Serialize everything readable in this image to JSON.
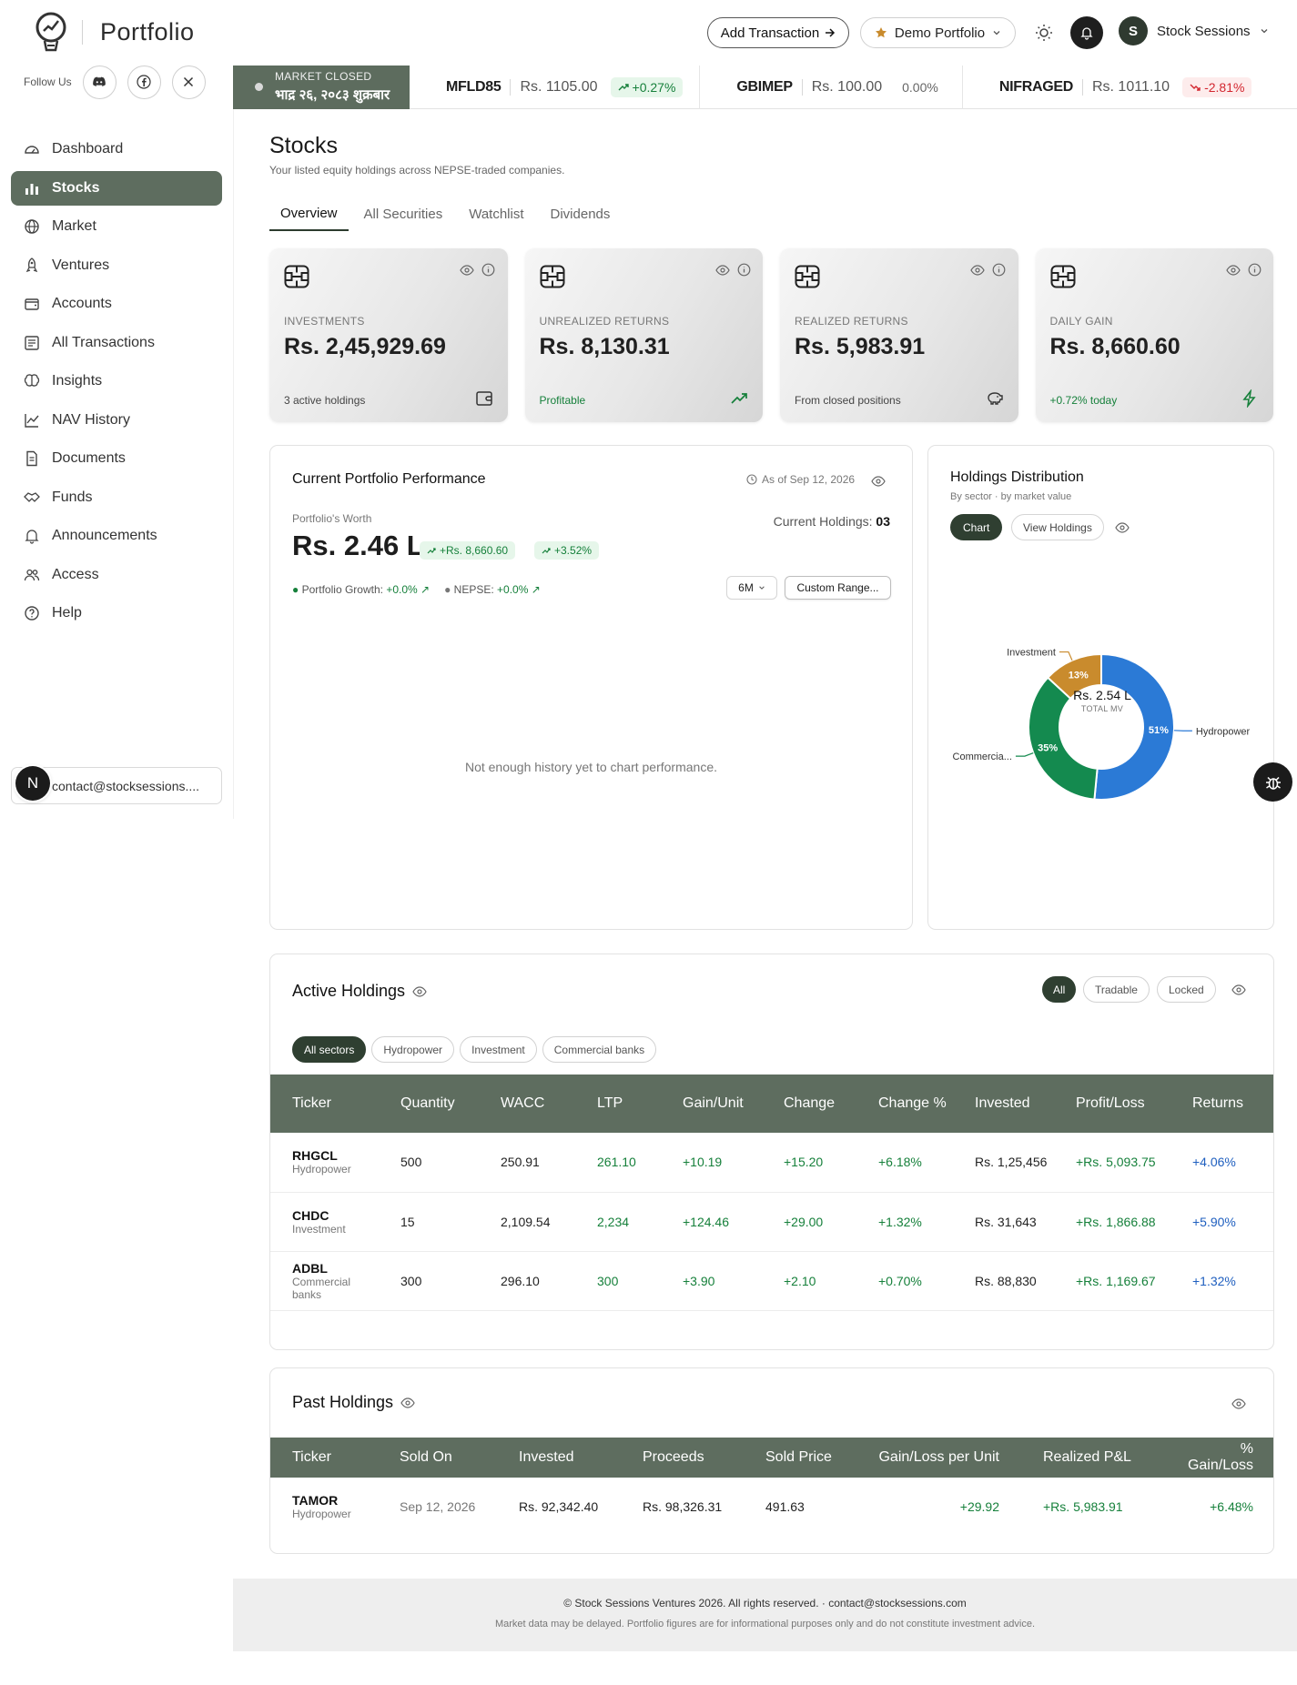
{
  "header": {
    "brand": "Portfolio",
    "add_transaction": "Add Transaction",
    "portfolio_select": "Demo Portfolio",
    "user_initial": "S",
    "user_name": "Stock Sessions"
  },
  "follow": {
    "label": "Follow Us"
  },
  "ticker": {
    "status": "MARKET CLOSED",
    "date": "भाद्र २६, २०८३ शुक्रबार",
    "items": [
      {
        "symbol": "MFLD85",
        "price": "Rs. 1105.00",
        "change": "+0.27%"
      },
      {
        "symbol": "GBIMEP",
        "price": "Rs. 100.00",
        "change": "0.00%"
      },
      {
        "symbol": "NIFRAGED",
        "price": "Rs. 1011.10",
        "change": "-2.81%"
      }
    ]
  },
  "sidebar": {
    "items": [
      {
        "label": "Dashboard"
      },
      {
        "label": "Stocks"
      },
      {
        "label": "Market"
      },
      {
        "label": "Ventures"
      },
      {
        "label": "Accounts"
      },
      {
        "label": "All Transactions"
      },
      {
        "label": "Insights"
      },
      {
        "label": "NAV History"
      },
      {
        "label": "Documents"
      },
      {
        "label": "Funds"
      },
      {
        "label": "Announcements"
      },
      {
        "label": "Access"
      },
      {
        "label": "Help"
      }
    ],
    "contact": "contact@stocksessions....",
    "avatar_initial": "N"
  },
  "page": {
    "title": "Stocks",
    "subtitle": "Your listed equity holdings across NEPSE-traded companies.",
    "tabs": [
      "Overview",
      "All Securities",
      "Watchlist",
      "Dividends"
    ]
  },
  "stats": [
    {
      "label": "INVESTMENTS",
      "value": "Rs. 2,45,929.69",
      "foot": "3 active holdings"
    },
    {
      "label": "UNREALIZED RETURNS",
      "value": "Rs. 8,130.31",
      "foot": "Profitable"
    },
    {
      "label": "REALIZED RETURNS",
      "value": "Rs. 5,983.91",
      "foot": "From closed positions"
    },
    {
      "label": "DAILY GAIN",
      "value": "Rs. 8,660.60",
      "foot": "+0.72% today"
    }
  ],
  "performance": {
    "title": "Current Portfolio Performance",
    "as_of": "As of Sep 12, 2026",
    "worth_label": "Portfolio's Worth",
    "worth": "Rs. 2.46 L",
    "gain_abs": "+Rs. 8,660.60",
    "gain_pct": "+3.52%",
    "holdings_label": "Current Holdings:",
    "holdings_count": "03",
    "growth_label": "Portfolio Growth:",
    "growth_value": "+0.0%",
    "nepse_label": "NEPSE:",
    "nepse_value": "+0.0%",
    "range": "6M",
    "custom_range": "Custom Range...",
    "empty": "Not enough history yet to chart performance."
  },
  "distribution": {
    "title": "Holdings Distribution",
    "subtitle": "By sector · by market value",
    "chart_tab": "Chart",
    "holdings_tab": "View Holdings",
    "center_value": "Rs. 2.54 L",
    "center_label": "TOTAL MV",
    "chart_data": {
      "type": "pie",
      "categories": [
        "Hydropower",
        "Commercia...",
        "Investment"
      ],
      "values": [
        51,
        35,
        13
      ],
      "labels": [
        "51%",
        "35%",
        "13%"
      ],
      "colors": [
        "#2b7ad6",
        "#148a4f",
        "#c98b2d"
      ]
    }
  },
  "active": {
    "title": "Active Holdings",
    "filters": [
      "All",
      "Tradable",
      "Locked"
    ],
    "sectors": [
      "All sectors",
      "Hydropower",
      "Investment",
      "Commercial banks"
    ],
    "columns": [
      "Ticker",
      "Quantity",
      "WACC",
      "LTP",
      "Gain/Unit",
      "Change",
      "Change %",
      "Invested",
      "Profit/Loss",
      "Returns"
    ],
    "rows": [
      {
        "ticker": "RHGCL",
        "sector": "Hydropower",
        "qty": "500",
        "wacc": "250.91",
        "ltp": "261.10",
        "gain": "+10.19",
        "change": "+15.20",
        "change_pct": "+6.18%",
        "invested": "Rs. 1,25,456",
        "pl": "+Rs. 5,093.75",
        "returns": "+4.06%"
      },
      {
        "ticker": "CHDC",
        "sector": "Investment",
        "qty": "15",
        "wacc": "2,109.54",
        "ltp": "2,234",
        "gain": "+124.46",
        "change": "+29.00",
        "change_pct": "+1.32%",
        "invested": "Rs. 31,643",
        "pl": "+Rs. 1,866.88",
        "returns": "+5.90%"
      },
      {
        "ticker": "ADBL",
        "sector": "Commercial banks",
        "qty": "300",
        "wacc": "296.10",
        "ltp": "300",
        "gain": "+3.90",
        "change": "+2.10",
        "change_pct": "+0.70%",
        "invested": "Rs. 88,830",
        "pl": "+Rs. 1,169.67",
        "returns": "+1.32%"
      }
    ]
  },
  "past": {
    "title": "Past Holdings",
    "columns": [
      "Ticker",
      "Sold On",
      "Invested",
      "Proceeds",
      "Sold Price",
      "Gain/Loss per Unit",
      "Realized P&L",
      "% Gain/Loss"
    ],
    "rows": [
      {
        "ticker": "TAMOR",
        "sector": "Hydropower",
        "sold_on": "Sep 12, 2026",
        "invested": "Rs. 92,342.40",
        "proceeds": "Rs. 98,326.31",
        "sold_price": "491.63",
        "gain_unit": "+29.92",
        "realized": "+Rs. 5,983.91",
        "pct": "+6.48%"
      }
    ]
  },
  "footer": {
    "line1": "© Stock Sessions Ventures 2026. All rights reserved. · contact@stocksessions.com",
    "line2": "Market data may be delayed. Portfolio figures are for informational purposes only and do not constitute investment advice."
  }
}
